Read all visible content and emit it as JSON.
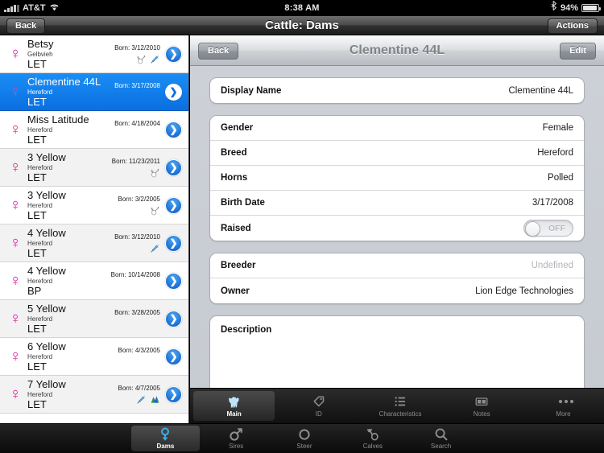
{
  "status_bar": {
    "carrier": "AT&T",
    "signal_icon": "signal-bars-icon",
    "wifi_icon": "wifi-icon",
    "time": "8:38 AM",
    "bluetooth_icon": "bluetooth-icon",
    "battery_percent": "94%",
    "battery_icon": "battery-icon"
  },
  "top_bar": {
    "back_label": "Back",
    "title": "Cattle: Dams",
    "actions_label": "Actions"
  },
  "master_list": {
    "rows": [
      {
        "gender_symbol": "♀",
        "name": "Betsy",
        "breed": "Gelbvieh",
        "tag": "LET",
        "born": "Born: 3/12/2010",
        "icons": [
          "calf-birth-icon",
          "syringe-icon"
        ],
        "selected": false,
        "alt": false
      },
      {
        "gender_symbol": "♀",
        "name": "Clementine 44L",
        "breed": "Hereford",
        "tag": "LET",
        "born": "Born: 3/17/2008",
        "icons": [],
        "selected": true,
        "alt": false
      },
      {
        "gender_symbol": "♀",
        "name": "Miss Latitude",
        "breed": "Hereford",
        "tag": "LET",
        "born": "Born: 4/18/2004",
        "icons": [],
        "selected": false,
        "alt": false
      },
      {
        "gender_symbol": "♀",
        "name": "3 Yellow",
        "breed": "Hereford",
        "tag": "LET",
        "born": "Born: 11/23/2011",
        "icons": [
          "calf-birth-icon"
        ],
        "selected": false,
        "alt": true
      },
      {
        "gender_symbol": "♀",
        "name": "3 Yellow",
        "breed": "Hereford",
        "tag": "LET",
        "born": "Born: 3/2/2005",
        "icons": [
          "calf-birth-icon"
        ],
        "selected": false,
        "alt": false
      },
      {
        "gender_symbol": "♀",
        "name": "4 Yellow",
        "breed": "Hereford",
        "tag": "LET",
        "born": "Born: 3/12/2010",
        "icons": [
          "syringe-icon"
        ],
        "selected": false,
        "alt": true
      },
      {
        "gender_symbol": "♀",
        "name": "4 Yellow",
        "breed": "Hereford",
        "tag": "BP",
        "born": "Born: 10/14/2008",
        "icons": [],
        "selected": false,
        "alt": false
      },
      {
        "gender_symbol": "♀",
        "name": "5 Yellow",
        "breed": "Hereford",
        "tag": "LET",
        "born": "Born: 3/28/2005",
        "icons": [],
        "selected": false,
        "alt": true
      },
      {
        "gender_symbol": "♀",
        "name": "6 Yellow",
        "breed": "Hereford",
        "tag": "LET",
        "born": "Born: 4/3/2005",
        "icons": [],
        "selected": false,
        "alt": false
      },
      {
        "gender_symbol": "♀",
        "name": "7 Yellow",
        "breed": "Hereford",
        "tag": "LET",
        "born": "Born: 4/7/2005",
        "icons": [
          "syringe-icon",
          "chart-icon"
        ],
        "selected": false,
        "alt": true
      }
    ],
    "disclosure_icon": "chevron-right-icon"
  },
  "detail": {
    "back_label": "Back",
    "title": "Clementine 44L",
    "edit_label": "Edit",
    "section_name": {
      "rows": [
        {
          "label": "Display Name",
          "value": "Clementine 44L"
        }
      ]
    },
    "section_attributes": {
      "rows": [
        {
          "label": "Gender",
          "value": "Female"
        },
        {
          "label": "Breed",
          "value": "Hereford"
        },
        {
          "label": "Horns",
          "value": "Polled"
        },
        {
          "label": "Birth Date",
          "value": "3/17/2008"
        }
      ],
      "toggle_row": {
        "label": "Raised",
        "state_label": "OFF",
        "on": false
      }
    },
    "section_people": {
      "rows": [
        {
          "label": "Breeder",
          "value": "Undefined",
          "muted": true
        },
        {
          "label": "Owner",
          "value": "Lion Edge Technologies",
          "muted": false
        }
      ]
    },
    "section_description": {
      "label": "Description",
      "value": ""
    },
    "inner_tabs": [
      {
        "label": "Main",
        "icon": "cow-icon",
        "active": true
      },
      {
        "label": "ID",
        "icon": "tag-icon",
        "active": false
      },
      {
        "label": "Characteristics",
        "icon": "list-icon",
        "active": false
      },
      {
        "label": "Notes",
        "icon": "notes-icon",
        "active": false
      },
      {
        "label": "More",
        "icon": "ellipsis-icon",
        "active": false
      }
    ]
  },
  "bottom_tabs": [
    {
      "label": "Dams",
      "icon": "female-symbol-icon",
      "active": true
    },
    {
      "label": "Sires",
      "icon": "male-symbol-icon",
      "active": false
    },
    {
      "label": "Steer",
      "icon": "circle-icon",
      "active": false
    },
    {
      "label": "Calves",
      "icon": "calf-icon",
      "active": false
    },
    {
      "label": "Search",
      "icon": "search-icon",
      "active": false
    }
  ],
  "colors": {
    "accent_blue": "#0a6fe0",
    "gender_pink": "#e0179b",
    "detail_bg": "#ccd0d6"
  }
}
